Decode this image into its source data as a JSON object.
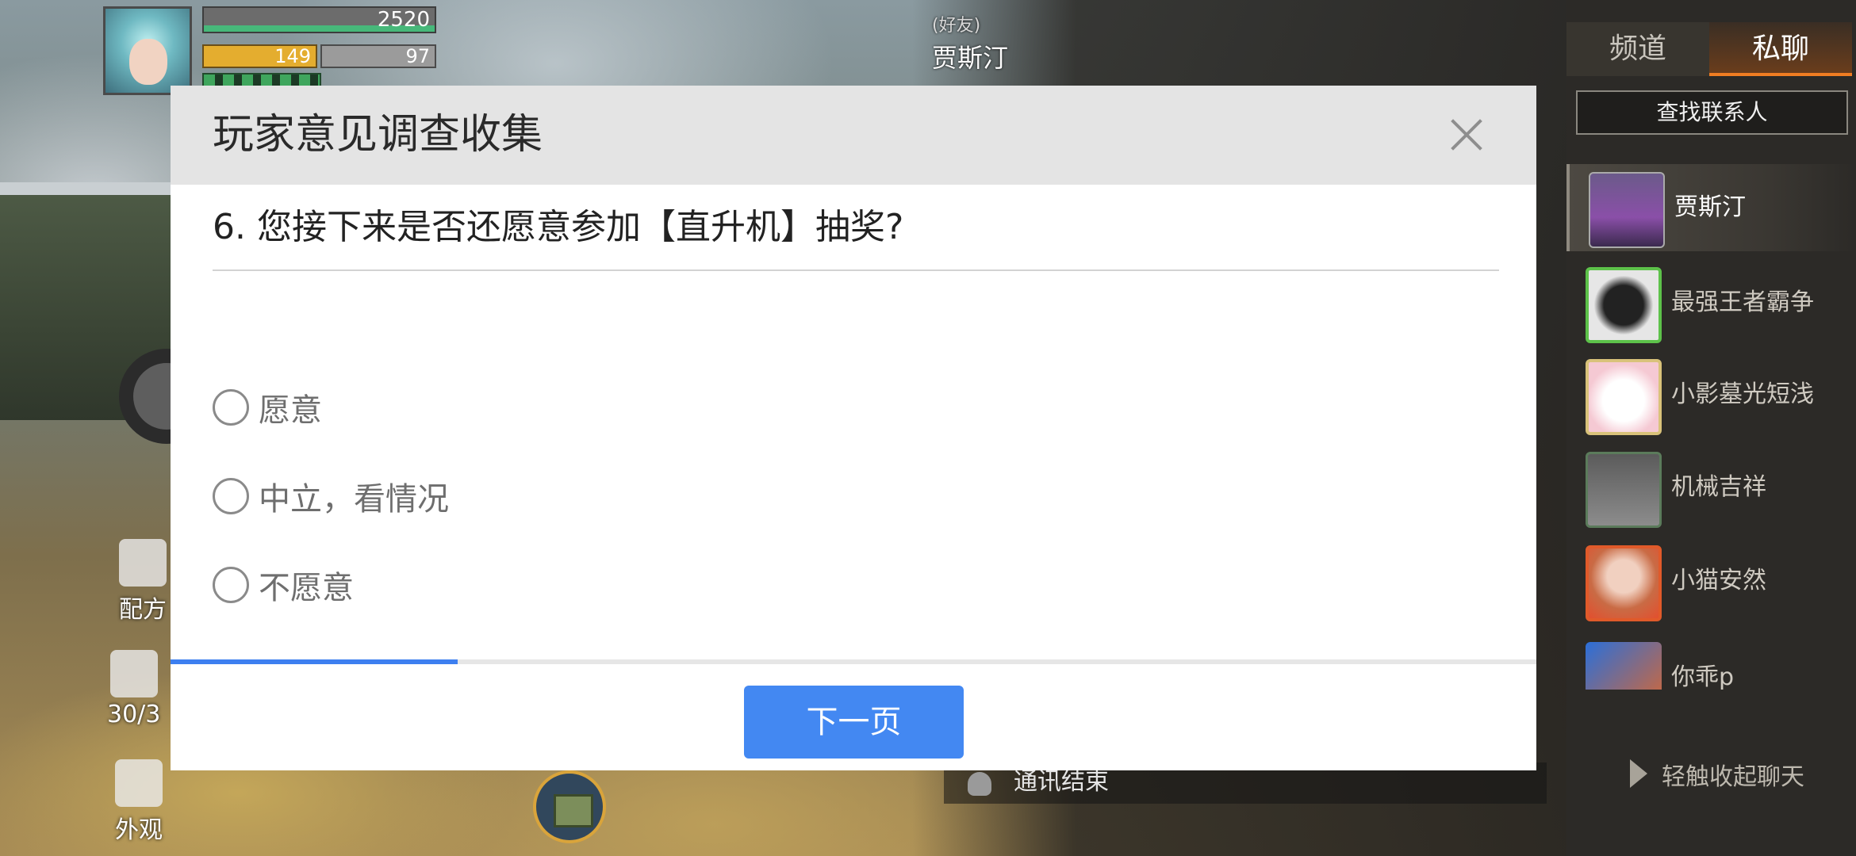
{
  "hud": {
    "health_value": "2520",
    "food_value": "149",
    "water_value": "97"
  },
  "side_buttons": {
    "recipe_label": "配方",
    "bag_count": "30/3",
    "appearance_label": "外观"
  },
  "chat_header": {
    "tag": "(好友)",
    "name": "贾斯汀"
  },
  "call_notice": "通讯结束",
  "chat_panel": {
    "tabs": [
      {
        "label": "频道",
        "active": false
      },
      {
        "label": "私聊",
        "active": true
      }
    ],
    "find_contact_label": "查找联系人",
    "contacts": [
      {
        "name": "贾斯汀",
        "selected": true
      },
      {
        "name": "最强王者霸争",
        "selected": false
      },
      {
        "name": "小影墓光短浅",
        "selected": false
      },
      {
        "name": "机械吉祥",
        "selected": false
      },
      {
        "name": "小猫安然",
        "selected": false
      },
      {
        "name": "你乖p",
        "selected": false
      }
    ],
    "collapse_label": "轻触收起聊天"
  },
  "survey": {
    "title": "玩家意见调查收集",
    "question": "6. 您接下来是否还愿意参加【直升机】抽奖?",
    "options": [
      "愿意",
      "中立，看情况",
      "不愿意"
    ],
    "progress": 0.21,
    "next_label": "下一页"
  },
  "colors": {
    "accent_blue": "#4388f2",
    "tab_active_orange": "#f07d22"
  }
}
